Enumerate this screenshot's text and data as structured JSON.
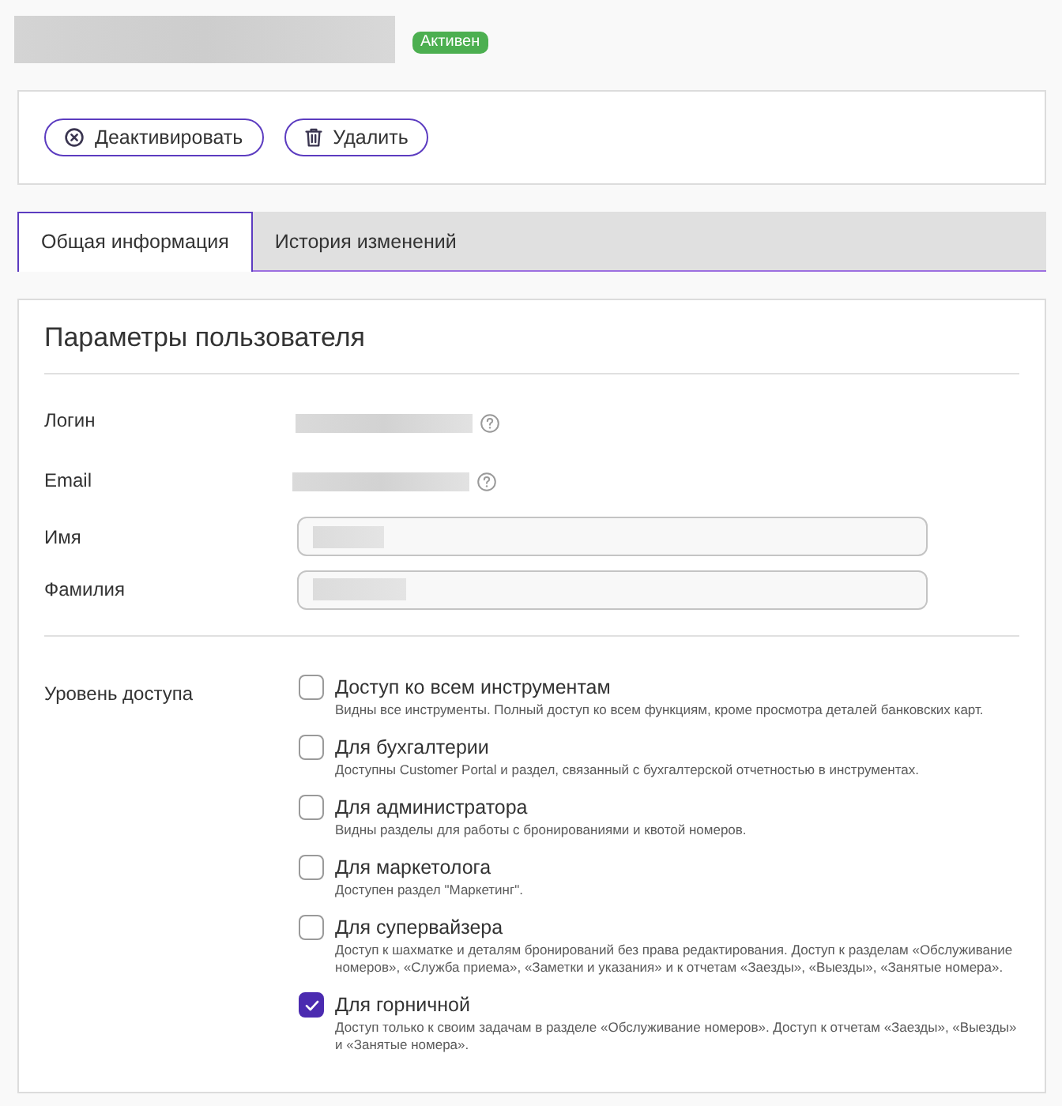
{
  "header": {
    "status_badge": "Активен"
  },
  "actions": [
    {
      "kind": "deactivate",
      "label": "Деактивировать"
    },
    {
      "kind": "delete",
      "label": "Удалить"
    }
  ],
  "tabs": [
    {
      "label": "Общая информация",
      "selected": true
    },
    {
      "label": "История изменений",
      "selected": false
    }
  ],
  "user_params": {
    "title": "Параметры пользователя",
    "fields": [
      {
        "kind": "readonly",
        "label": "Логин"
      },
      {
        "kind": "readonly",
        "label": "Email"
      },
      {
        "kind": "input",
        "label": "Имя"
      },
      {
        "kind": "input",
        "label": "Фамилия"
      }
    ]
  },
  "access_level": {
    "label": "Уровень доступа",
    "options": [
      {
        "title": "Доступ ко всем инструментам",
        "description": "Видны все инструменты. Полный доступ ко всем функциям, кроме просмотра деталей банковских карт.",
        "checked": false
      },
      {
        "title": "Для бухгалтерии",
        "description": "Доступны Customer Portal и раздел, связанный с бухгалтерской отчетностью в инструментах.",
        "checked": false
      },
      {
        "title": "Для администратора",
        "description": "Видны разделы для работы с бронированиями и квотой номеров.",
        "checked": false
      },
      {
        "title": "Для маркетолога",
        "description": "Доступен раздел \"Маркетинг\".",
        "checked": false
      },
      {
        "title": "Для супервайзера",
        "description": "Доступ к шахматке и деталям бронирований без права редактирования. Доступ к разделам «Обслуживание номеров», «Служба приема», «Заметки и указания» и к отчетам «Заезды», «Выезды», «Занятые номера».",
        "checked": false
      },
      {
        "title": "Для горничной",
        "description": "Доступ только к своим задачам в разделе «Обслуживание номеров». Доступ к отчетам «Заезды», «Выезды» и «Занятые номера».",
        "checked": true
      }
    ]
  }
}
